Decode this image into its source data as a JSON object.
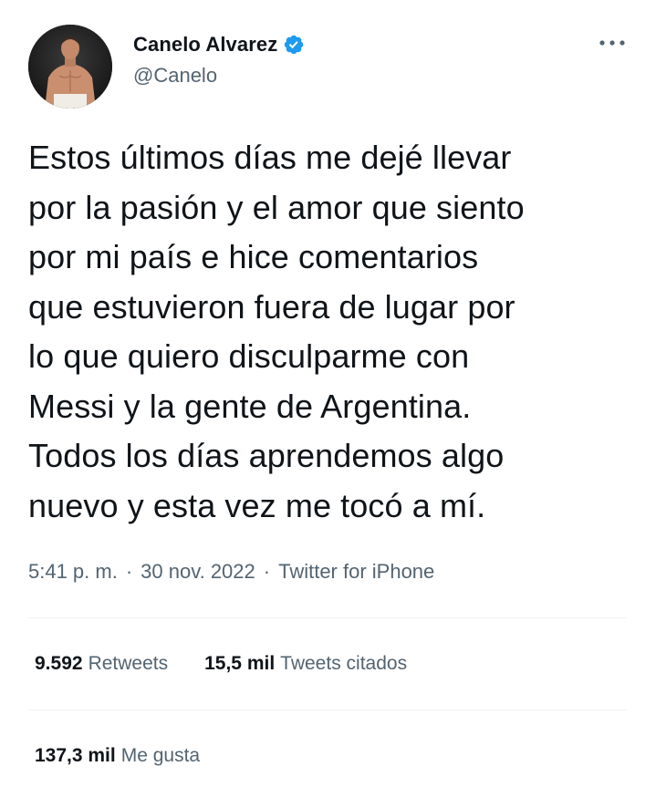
{
  "tweet": {
    "author": {
      "display_name": "Canelo Alvarez",
      "handle": "@Canelo",
      "verified_icon": "verified-badge-icon",
      "avatar_icon": "profile-avatar"
    },
    "text": "Estos últimos días me dejé llevar\npor la pasión y el amor que siento\npor mi país e hice comentarios\nque estuvieron fuera de lugar por\nlo que quiero disculparme con\nMessi y la gente de Argentina.\nTodos los días aprendemos algo\nnuevo y esta vez me tocó a mí.",
    "time": "5:41 p. m.",
    "date": "30 nov. 2022",
    "separator": "·",
    "source": "Twitter for iPhone",
    "stats": {
      "retweets_count": "9.592",
      "retweets_label": "Retweets",
      "quotes_count": "15,5 mil",
      "quotes_label": "Tweets citados",
      "likes_count": "137,3 mil",
      "likes_label": "Me gusta"
    },
    "more_icon": "more-options-icon",
    "colors": {
      "text_primary": "#0f1419",
      "text_secondary": "#536471",
      "verified_blue": "#1d9bf0",
      "divider": "#eff3f4"
    }
  }
}
